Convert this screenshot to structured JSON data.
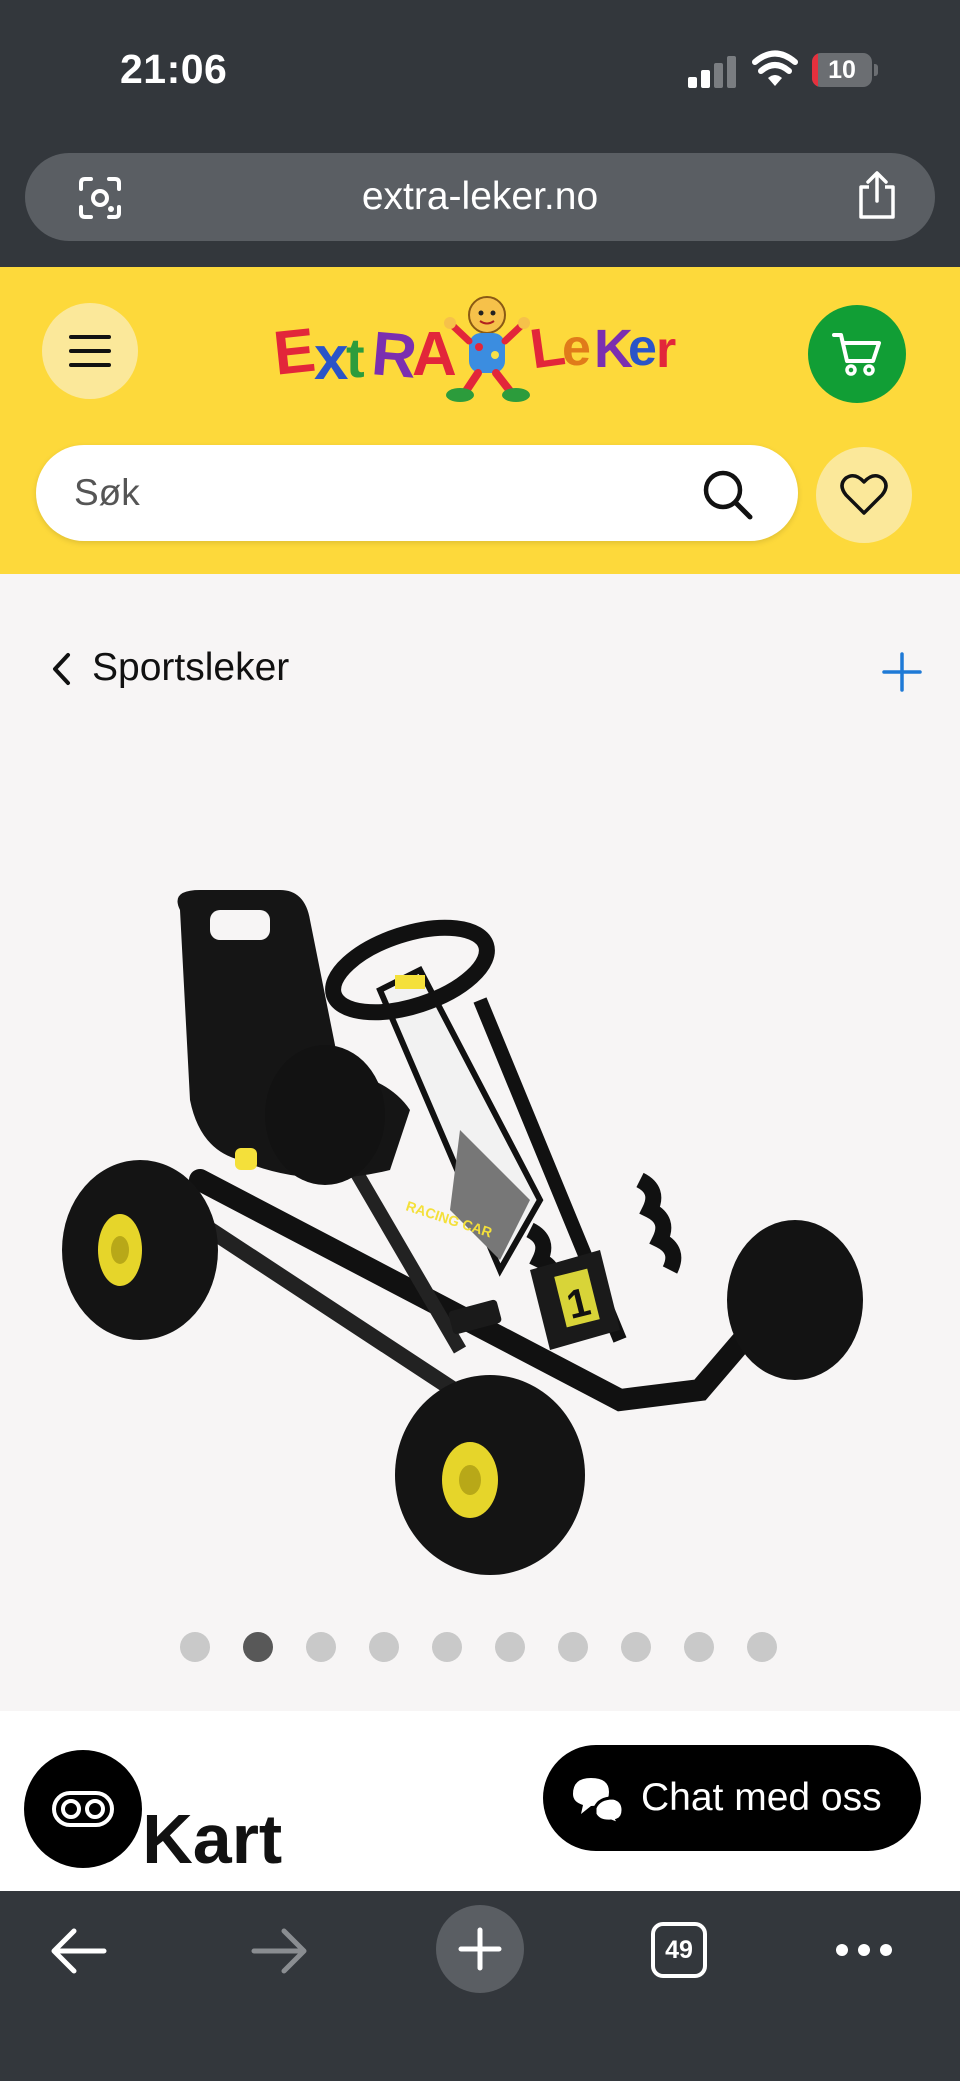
{
  "status_bar": {
    "time": "21:06",
    "battery_level": "10",
    "battery_fraction": 0.1,
    "signal_bars_active": 2,
    "signal_bars_total": 4
  },
  "browser": {
    "url": "extra-leker.no",
    "open_tabs": "49"
  },
  "header": {
    "logo_text": "ExtraLeker",
    "search_placeholder": "Søk",
    "colors": {
      "header_bg": "#fdd93b",
      "cart_green": "#119e35",
      "button_light": "#fbe89a"
    }
  },
  "breadcrumb": {
    "label": "Sportsleker"
  },
  "product": {
    "title_visible": "o Kart",
    "image_label": "RACING CAR",
    "image_number": "1",
    "carousel": {
      "total": 10,
      "active_index": 1
    }
  },
  "chat": {
    "label": "Chat med oss"
  },
  "icons": {
    "lens": "lens-icon",
    "share": "share-icon",
    "menu": "hamburger-menu-icon",
    "cart": "cart-icon",
    "search": "search-icon",
    "heart": "heart-icon",
    "back": "chevron-left-icon",
    "plus": "plus-icon",
    "chat": "chat-bubbles-icon"
  }
}
